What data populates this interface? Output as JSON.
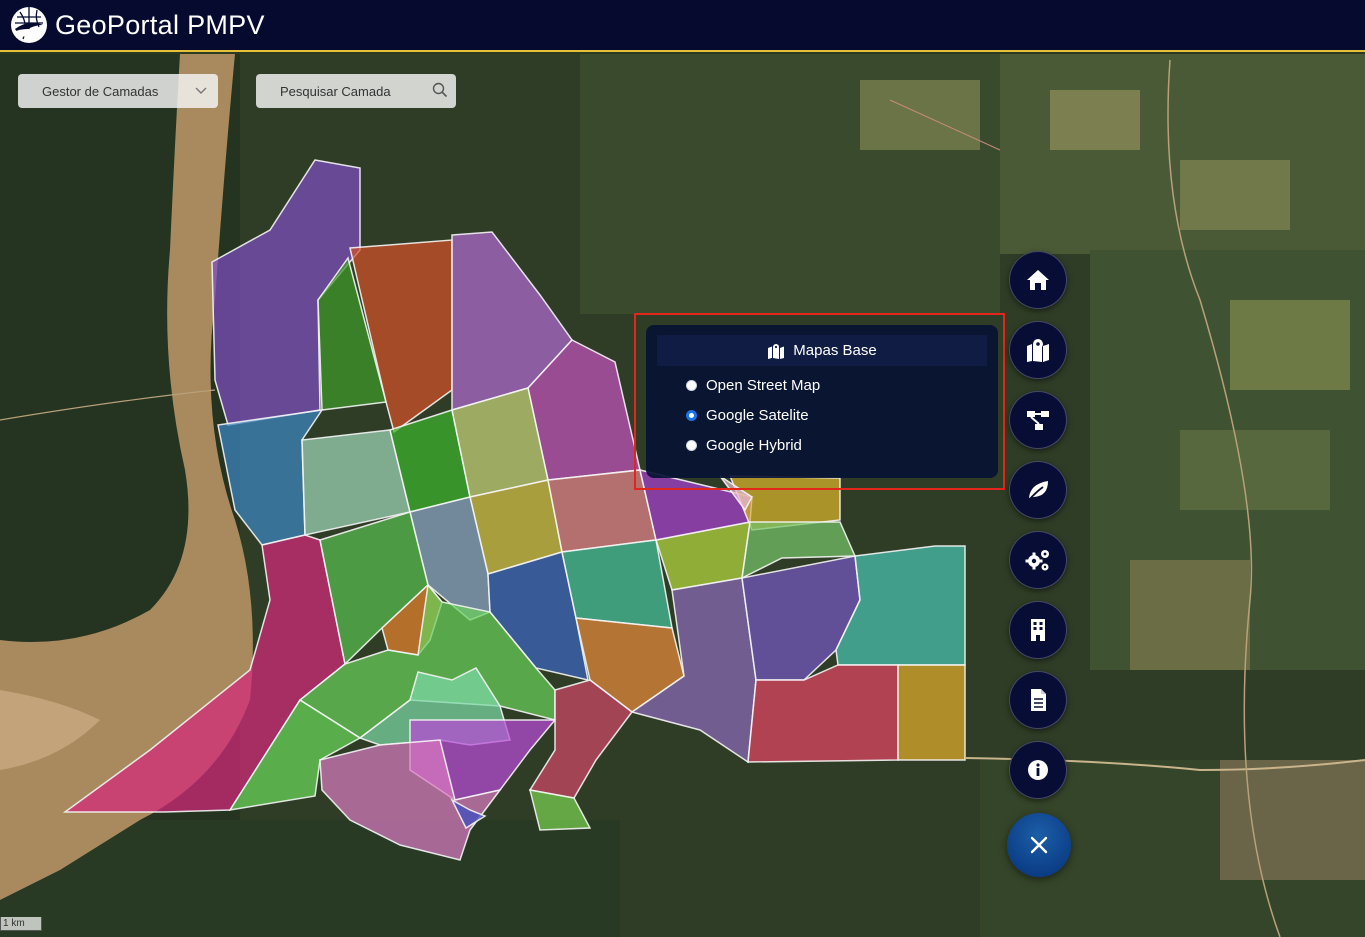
{
  "header": {
    "title": "GeoPortal PMPV"
  },
  "toolbar": {
    "layers_label": "Gestor de Camadas",
    "search_label": "Pesquisar Camada"
  },
  "basemap_panel": {
    "title": "Mapas Base",
    "options": [
      {
        "label": "Open Street Map",
        "selected": false
      },
      {
        "label": "Google Satelite",
        "selected": true
      },
      {
        "label": "Google Hybrid",
        "selected": false
      }
    ]
  },
  "side_buttons": [
    "home-icon",
    "map-icon",
    "network-icon",
    "leaf-icon",
    "gears-icon",
    "building-icon",
    "document-icon",
    "info-icon",
    "close-icon"
  ],
  "scale": {
    "label": "1 km"
  },
  "colors": {
    "header_bg": "#050a2e",
    "header_border": "#e5c039",
    "highlight": "#e1261c",
    "fab_bg": "#070d35",
    "fab_close": "#0c3f87"
  }
}
